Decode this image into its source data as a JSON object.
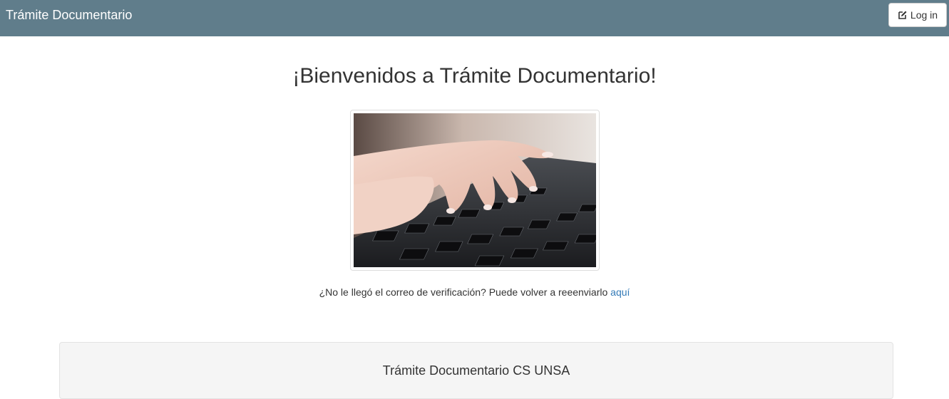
{
  "navbar": {
    "brand": "Trámite Documentario",
    "login_label": "Log in",
    "login_icon": "edit-icon",
    "background_color": "#607d8b"
  },
  "main": {
    "title": "¡Bienvenidos a Trámite Documentario!",
    "image_icon": "keyboard-typing-photo",
    "verify_text": "¿No le llegó el correo de verificación? Puede volver a reeenviarlo",
    "verify_link": "aquí",
    "link_color": "#337ab7"
  },
  "footer": {
    "title": "Trámite Documentario CS UNSA"
  }
}
